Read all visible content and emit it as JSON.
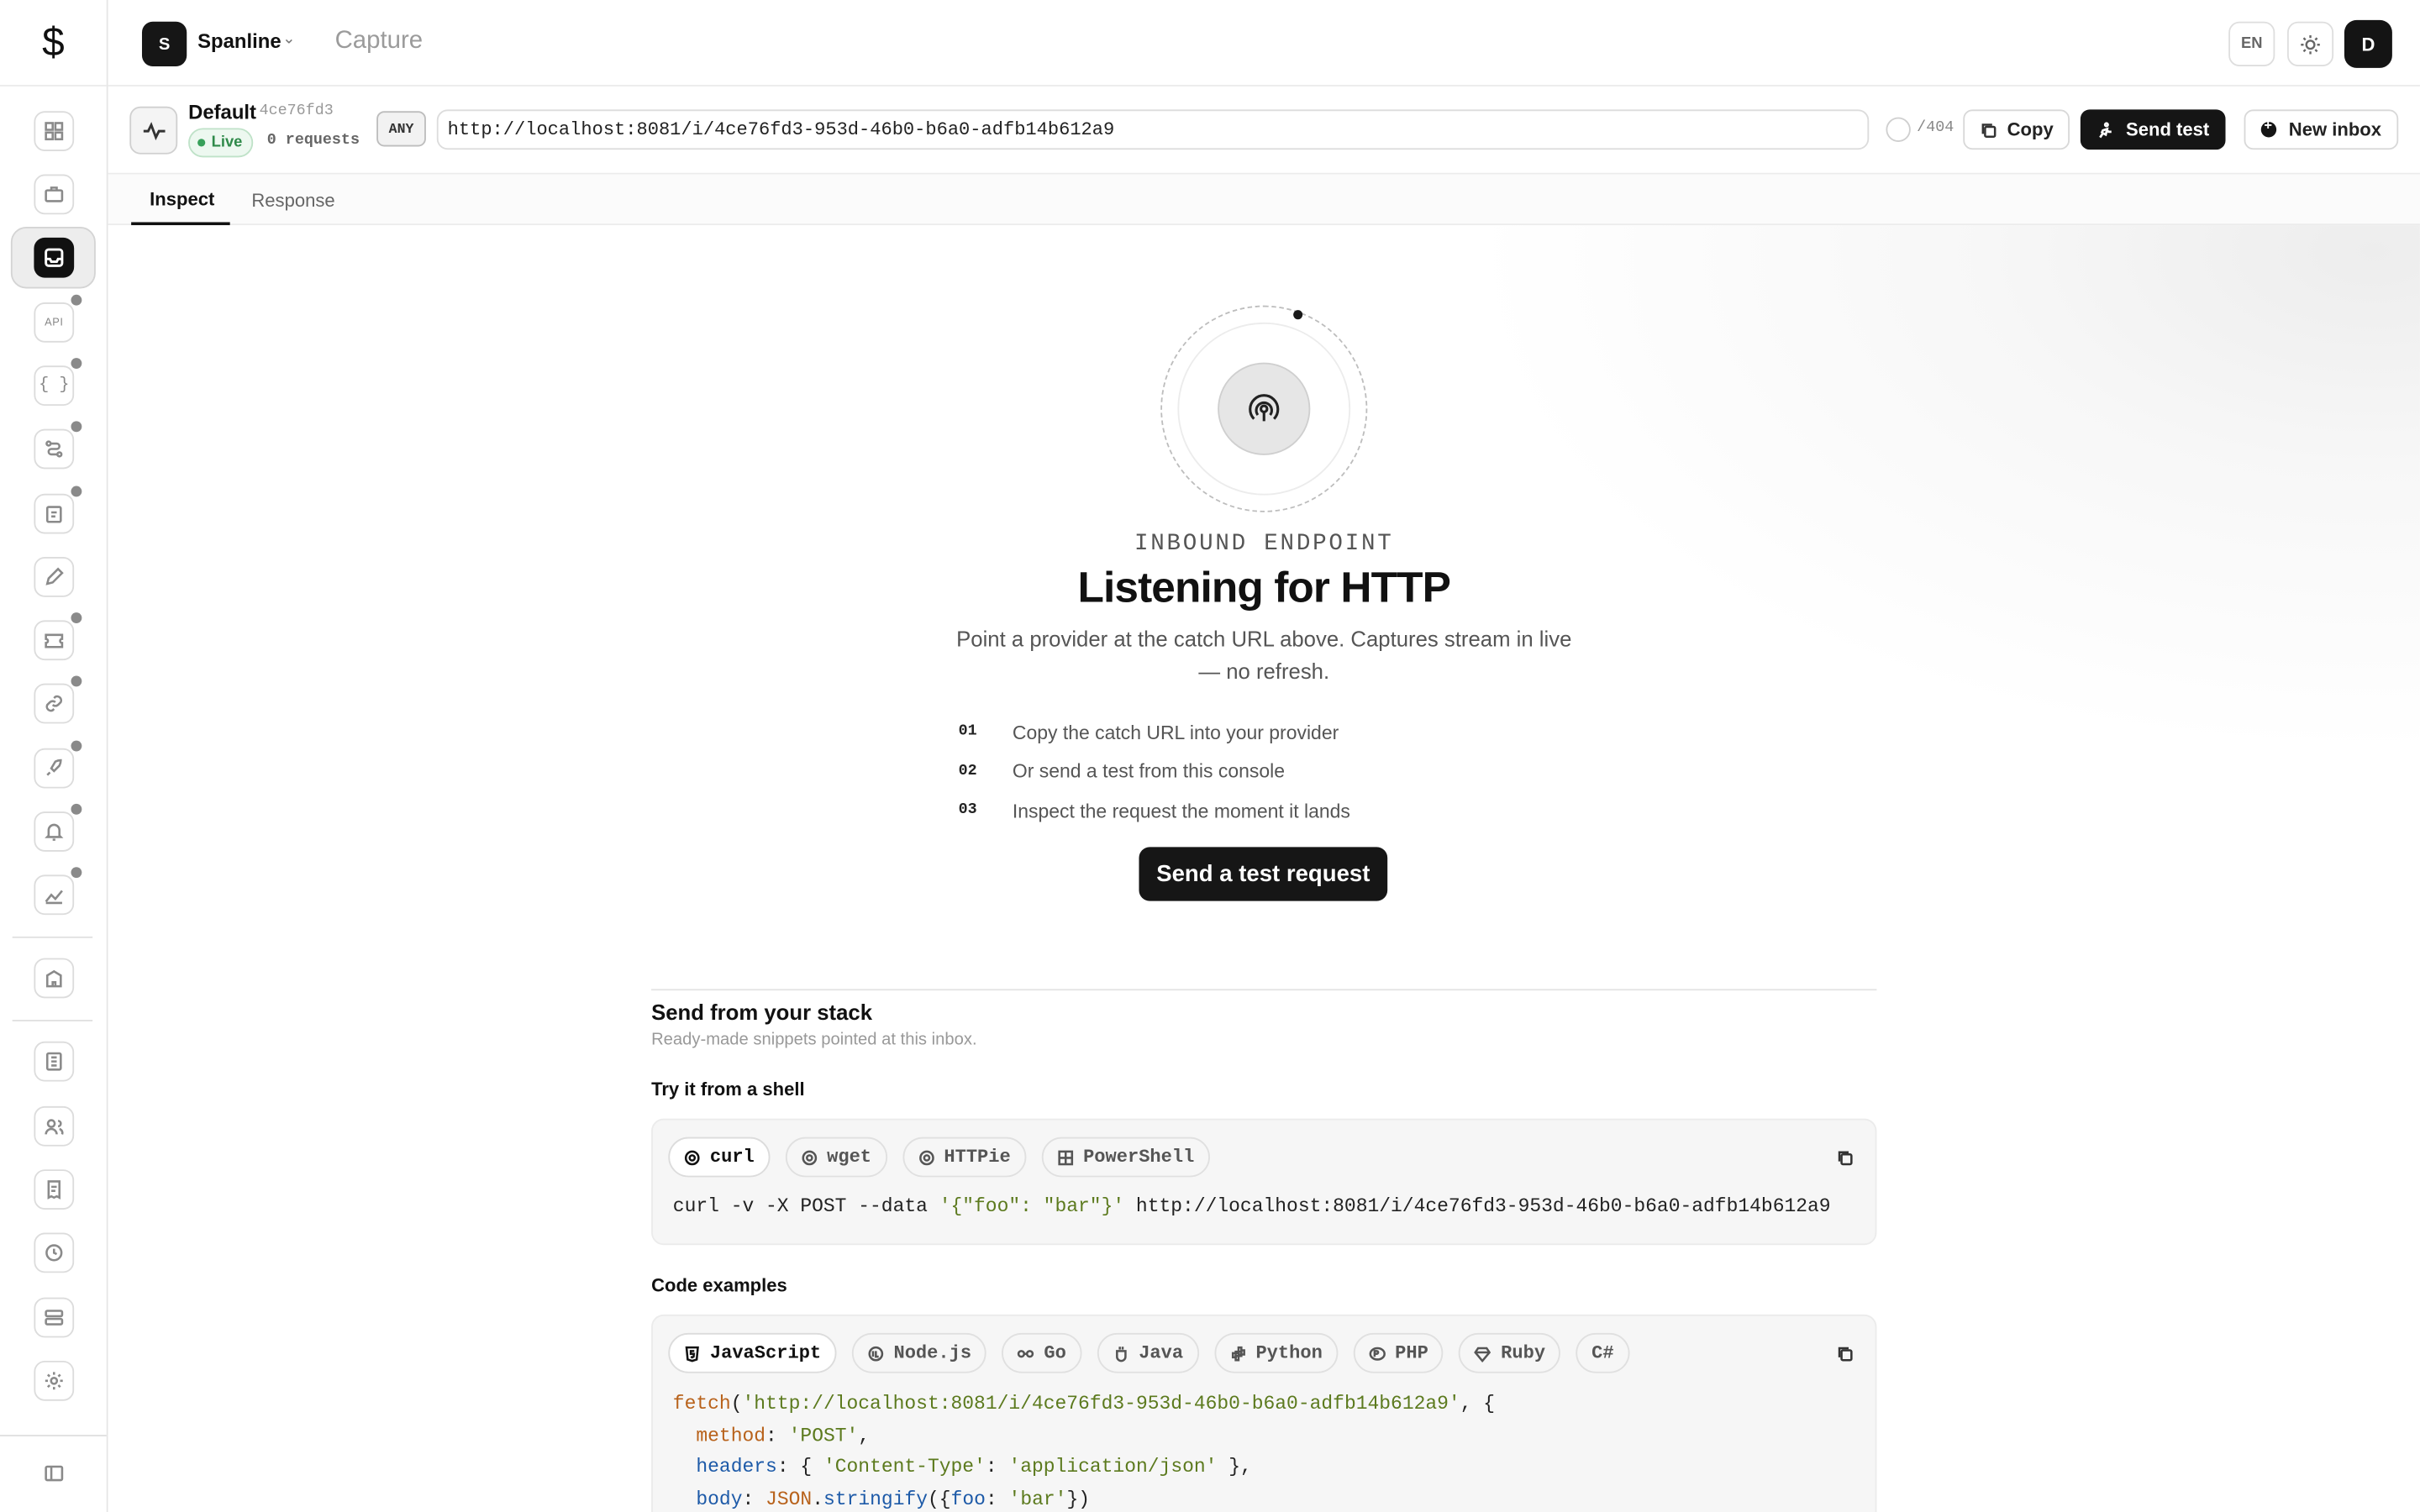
{
  "app": {
    "logo_glyph": "$",
    "workspace_initial": "S",
    "workspace_name": "Spanline",
    "page_title": "Capture",
    "lang": "EN",
    "user_initial": "D"
  },
  "sidebar": {
    "api_label": "API",
    "braces_label": "{ }",
    "icons": [
      "dashboard-icon",
      "briefcase-icon",
      "inbox-icon",
      "api-icon",
      "braces-icon",
      "workflow-icon",
      "clipboard-icon",
      "pen-icon",
      "ticket-icon",
      "link-icon",
      "rocket-icon",
      "bell-icon",
      "analytics-icon",
      "building-icon",
      "document-icon",
      "users-icon",
      "receipt-icon",
      "history-icon",
      "storage-icon",
      "settings-icon",
      "sidebar-toggle-icon"
    ]
  },
  "inbox": {
    "name": "Default",
    "id": "4ce76fd3",
    "live_label": "Live",
    "requests_label": "0 requests",
    "method": "ANY",
    "url": "http://localhost:8081/i/4ce76fd3-953d-46b0-b6a0-adfb14b612a9",
    "status_code": "/404",
    "copy_label": "Copy",
    "send_test_label": "Send test",
    "new_inbox_label": "New inbox"
  },
  "tabs": [
    {
      "label": "Inspect",
      "active": true
    },
    {
      "label": "Response",
      "active": false
    }
  ],
  "empty_state": {
    "eyebrow": "INBOUND ENDPOINT",
    "title": "Listening for HTTP",
    "subtitle": "Point a provider at the catch URL above. Captures stream in live — no refresh.",
    "steps": [
      {
        "num": "01",
        "text": "Copy the catch URL into your provider"
      },
      {
        "num": "02",
        "text": "Or send a test from this console"
      },
      {
        "num": "03",
        "text": "Inspect the request the moment it lands"
      }
    ],
    "cta_label": "Send a test request"
  },
  "stack": {
    "title": "Send from your stack",
    "subtitle": "Ready-made snippets pointed at this inbox.",
    "shell_label": "Try it from a shell",
    "shell_tabs": [
      "curl",
      "wget",
      "HTTPie",
      "PowerShell"
    ],
    "shell_active": "curl",
    "shell_code": {
      "cmd": "curl -v -X POST --data ",
      "data": "'{\"foo\": \"bar\"}'",
      "url": " http://localhost:8081/i/4ce76fd3-953d-46b0-b6a0-adfb14b612a9"
    },
    "code_label": "Code examples",
    "code_tabs": [
      "JavaScript",
      "Node.js",
      "Go",
      "Java",
      "Python",
      "PHP",
      "Ruby",
      "C#"
    ],
    "code_active": "JavaScript",
    "js_code": {
      "fn": "fetch",
      "url": "'http://localhost:8081/i/4ce76fd3-953d-46b0-b6a0-adfb14b612a9'",
      "open": ", {",
      "method_key": "method",
      "method_val": "'POST'",
      "headers_key": "headers",
      "headers_open": ": { ",
      "ct_key": "'Content-Type'",
      "ct_val": "'application/json'",
      "headers_close": " },",
      "body_key": "body",
      "json_obj": "JSON",
      "stringify": "stringify",
      "foo_key": "foo",
      "foo_val": "'bar'"
    }
  }
}
